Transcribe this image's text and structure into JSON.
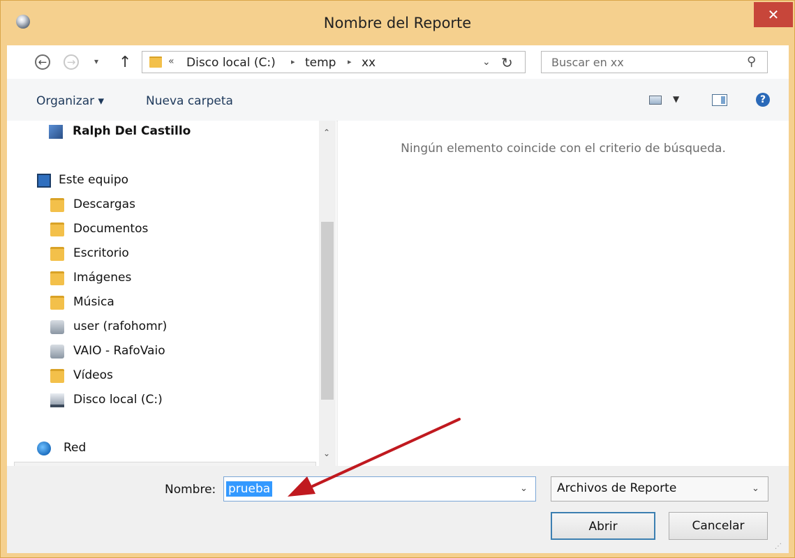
{
  "window": {
    "title": "Nombre del Reporte",
    "close_glyph": "✕"
  },
  "address": {
    "back_glyph": "←",
    "forward_glyph": "→",
    "recent_glyph": "▾",
    "up_glyph": "↑",
    "overflow": "«",
    "crumbs": [
      "Disco local (C:)",
      "temp",
      "xx"
    ],
    "separator": "▸",
    "dropdown_glyph": "⌄",
    "refresh_glyph": "↻"
  },
  "search": {
    "placeholder": "Buscar en xx",
    "icon_glyph": "⚲"
  },
  "toolbar": {
    "organize_label": "Organizar ▾",
    "new_folder_label": "Nueva carpeta",
    "view_drop_glyph": "▼",
    "help_glyph": "?"
  },
  "nav": {
    "user": "Ralph Del Castillo",
    "this_pc": "Este equipo",
    "items": [
      "Descargas",
      "Documentos",
      "Escritorio",
      "Imágenes",
      "Música",
      "user (rafohomr)",
      "VAIO - RafoVaio",
      "Vídeos",
      "Disco local (C:)"
    ],
    "network": "Red",
    "scroll_up_glyph": "⌃",
    "scroll_down_glyph": "⌄"
  },
  "content": {
    "empty_message": "Ningún elemento coincide con el criterio de búsqueda."
  },
  "footer": {
    "name_label": "Nombre:",
    "name_value": "prueba",
    "name_drop_glyph": "⌄",
    "filetype_value": "Archivos de Reporte",
    "filetype_drop_glyph": "⌄",
    "open_label": "Abrir",
    "cancel_label": "Cancelar",
    "grip_glyph": "⋰"
  },
  "colors": {
    "accent": "#3399ff",
    "annotation_arrow": "#c0191f",
    "frame": "#f5d08e"
  }
}
